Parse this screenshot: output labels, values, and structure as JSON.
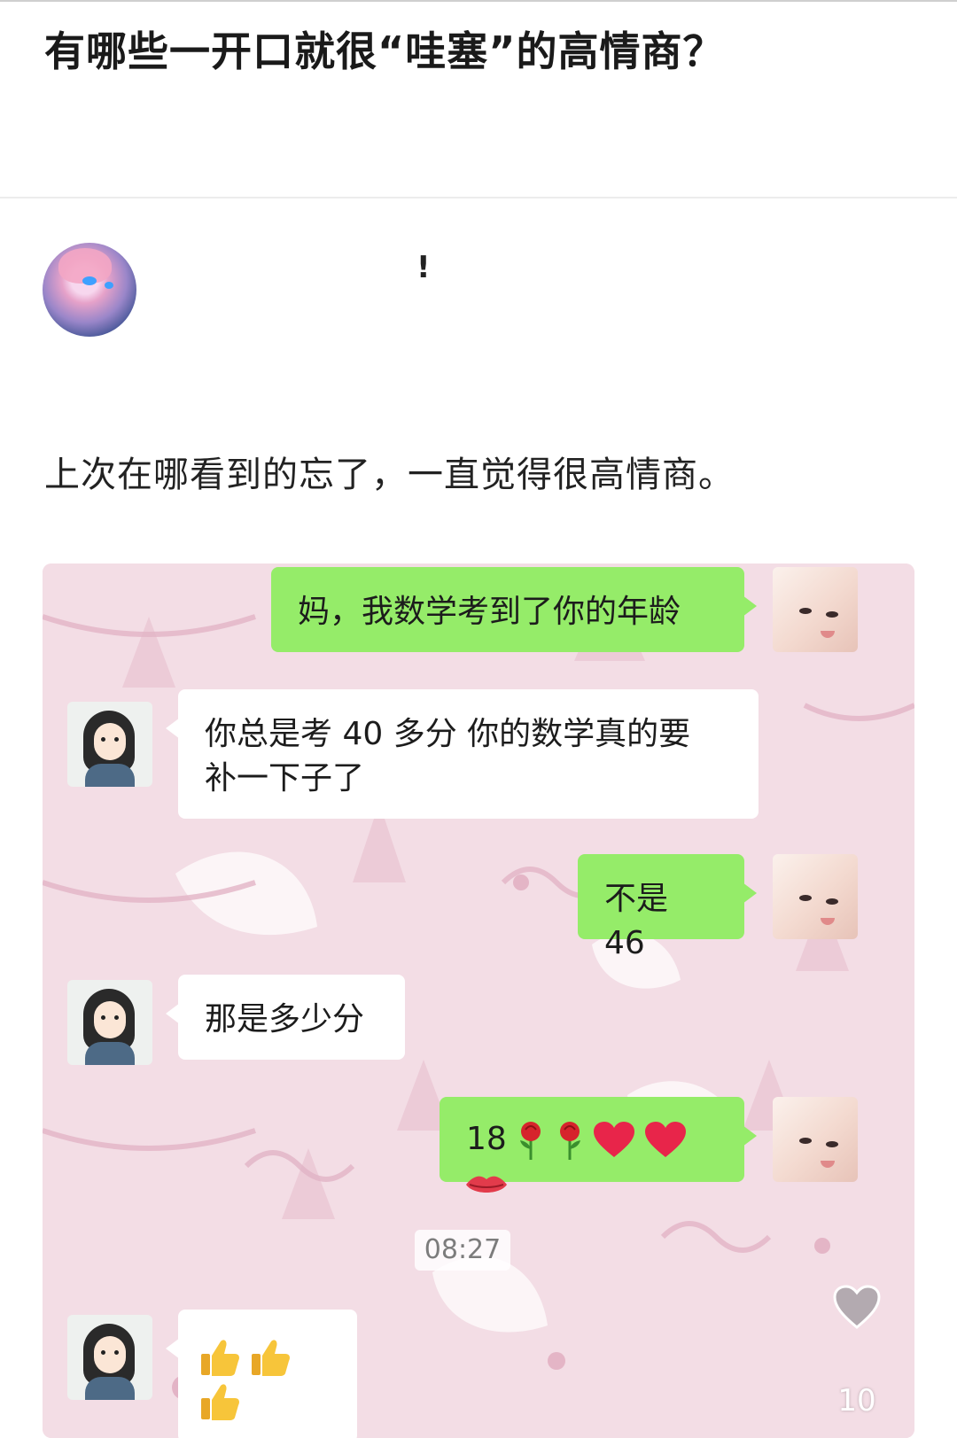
{
  "question": {
    "title": "有哪些一开口就很“哇塞”的高情商？"
  },
  "author": {
    "name": "!"
  },
  "post": {
    "body": "上次在哪看到的忘了，一直觉得很高情商。"
  },
  "chat": {
    "messages": [
      {
        "side": "right",
        "text": "妈，我数学考到了你的年龄"
      },
      {
        "side": "left",
        "line1": "你总是考 40 多分  你的数学真的要",
        "line2": "补一下子了"
      },
      {
        "side": "right",
        "text": "不是 46"
      },
      {
        "side": "left",
        "text": "那是多少分"
      },
      {
        "side": "right",
        "text": "18",
        "emoji": [
          "rose-icon",
          "rose-icon",
          "heart-icon",
          "heart-icon",
          "lips-icon"
        ]
      },
      {
        "side": "left",
        "emoji": [
          "thumbs-up-icon",
          "thumbs-up-icon",
          "thumbs-up-icon"
        ]
      }
    ],
    "timestamp": "08:27"
  },
  "reactions": {
    "like_count": "10"
  },
  "colors": {
    "self_bubble": "#95ec69",
    "other_bubble": "#ffffff",
    "chat_bg": "#f2dbe3"
  }
}
